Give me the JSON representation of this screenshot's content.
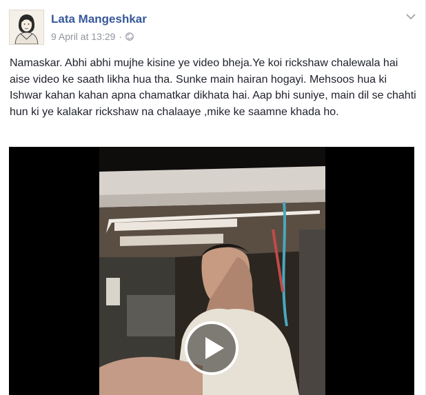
{
  "post": {
    "author": "Lata Mangeshkar",
    "date": "9 April at 13:29",
    "separator": "·",
    "privacy_icon": "globe-icon",
    "menu_icon": "chevron-down-icon",
    "text": "Namaskar. Abhi abhi mujhe kisine ye video bheja.Ye koi rickshaw chalewala hai aise video ke saath likha hua tha. Sunke main hairan hogayi. Mehsoos hua ki Ishwar kahan kahan apna chamatkar dikhata hai. Aap bhi suniye, main dil se chahti hun ki ye kalakar rickshaw na chalaaye ,mike ke saamne khada ho."
  },
  "video": {
    "play_icon": "play-icon"
  },
  "colors": {
    "author_link": "#365899",
    "meta_text": "#90949c",
    "body_text": "#1d2129"
  }
}
